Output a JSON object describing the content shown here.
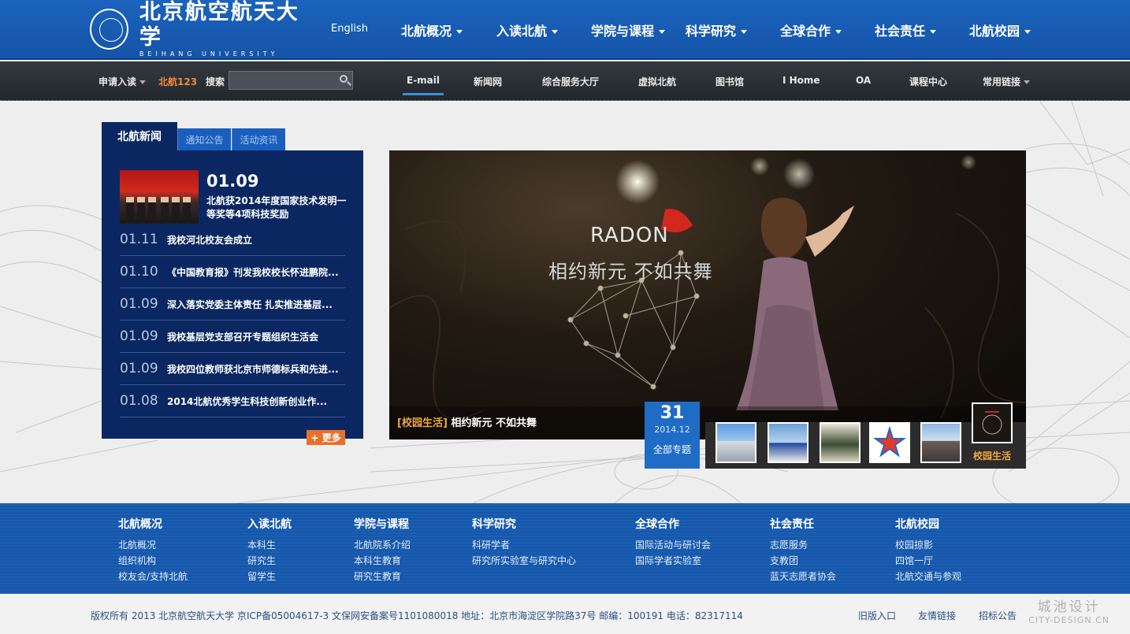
{
  "header": {
    "logo_cn": "北京航空航天大学",
    "logo_en": "BEIHANG UNIVERSITY",
    "lang_link": "English",
    "nav": [
      "北航概况",
      "入读北航",
      "学院与课程",
      "科学研究",
      "全球合作",
      "社会责任",
      "北航校园"
    ]
  },
  "subbar": {
    "apply": "申请入读",
    "beihang123": "北航123",
    "search_label": "搜索",
    "search_placeholder": "",
    "links": [
      "E-mail",
      "新闻网",
      "综合服务大厅",
      "虚拟北航",
      "图书馆",
      "I Home",
      "OA",
      "课程中心",
      "常用链接"
    ],
    "active_link": "E-mail"
  },
  "news": {
    "tabs": [
      "北航新闻",
      "通知公告",
      "活动资讯"
    ],
    "featured": {
      "date": "01.09",
      "title": "北航获2014年度国家技术发明一等奖等4项科技奖励"
    },
    "items": [
      {
        "date": "01.11",
        "title": "我校河北校友会成立"
      },
      {
        "date": "01.10",
        "title": "《中国教育报》刊发我校校长怀进鹏院..."
      },
      {
        "date": "01.09",
        "title": "深入落实党委主体责任 扎实推进基层..."
      },
      {
        "date": "01.09",
        "title": "我校基层党支部召开专题组织生活会"
      },
      {
        "date": "01.09",
        "title": "我校四位教师获北京市师德标兵和先进..."
      },
      {
        "date": "01.08",
        "title": "2014北航优秀学生科技创新创业作..."
      }
    ],
    "more": "+ 更多"
  },
  "banner": {
    "brand": "RADON",
    "slogan": "相约新元  不如共舞",
    "caption_tag": "[校园生活]",
    "caption_text": " 相约新元    不如共舞"
  },
  "special": {
    "day": "31",
    "year_month": "2014.12",
    "all_label": "全部专题"
  },
  "thumbs": {
    "active_label": "校园生活"
  },
  "footer": {
    "columns": [
      {
        "title": "北航概况",
        "links": [
          "北航概况",
          "组织机构",
          "校友会/支持北航"
        ]
      },
      {
        "title": "入读北航",
        "links": [
          "本科生",
          "研究生",
          "留学生"
        ]
      },
      {
        "title": "学院与课程",
        "links": [
          "北航院系介绍",
          "本科生教育",
          "研究生教育"
        ]
      },
      {
        "title": "科学研究",
        "links": [
          "科研学者",
          "研究所实验室与研究中心"
        ]
      },
      {
        "title": "全球合作",
        "links": [
          "国际活动与研讨会",
          "国际学者实验室"
        ]
      },
      {
        "title": "社会责任",
        "links": [
          "志愿服务",
          "支教团",
          "蓝天志愿者协会"
        ]
      },
      {
        "title": "北航校园",
        "links": [
          "校园掠影",
          "四馆一厅",
          "北航交通与参观"
        ]
      }
    ],
    "copyright": "版权所有 2013 北京航空航天大学 京ICP备05004617-3 文保网安备案号1101080018 地址：北京市海淀区学院路37号 邮编：100191 电话：82317114",
    "links": [
      "旧版入口",
      "友情链接",
      "招标公告"
    ],
    "watermark_cn": "城池设计",
    "watermark_en": "CITY-DESIGN.CN"
  },
  "colors": {
    "primary_blue": "#1b63bd",
    "dark_navy": "#0b2761",
    "accent_orange": "#e8712c",
    "caption_gold": "#f0a83a"
  }
}
